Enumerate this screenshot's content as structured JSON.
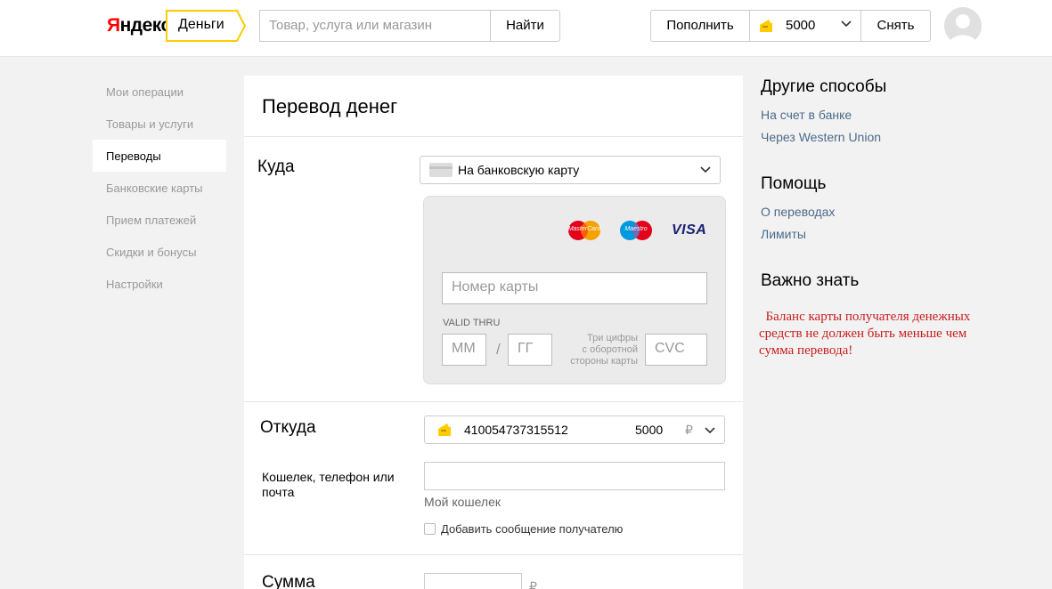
{
  "header": {
    "logo_y": "Я",
    "logo_rest": "ндекс",
    "service_tab": "Деньги",
    "search_placeholder": "Товар, услуга или магазин",
    "search_button": "Найти",
    "topup_button": "Пополнить",
    "balance": "5000",
    "withdraw_button": "Снять"
  },
  "sidebar": {
    "items": [
      {
        "label": "Мои операции",
        "active": false
      },
      {
        "label": "Товары и услуги",
        "active": false
      },
      {
        "label": "Переводы",
        "active": true
      },
      {
        "label": "Банковские карты",
        "active": false
      },
      {
        "label": "Прием платежей",
        "active": false
      },
      {
        "label": "Скидки и бонусы",
        "active": false
      },
      {
        "label": "Настройки",
        "active": false
      }
    ]
  },
  "main": {
    "title": "Перевод денег",
    "to": {
      "label": "Куда",
      "method_selected": "На банковскую карту",
      "card_logos": {
        "mastercard": "MasterCard",
        "maestro": "Maestro",
        "visa": "VISA"
      },
      "card_number_placeholder": "Номер карты",
      "valid_thru_label": "VALID THRU",
      "month_placeholder": "ММ",
      "date_separator": "/",
      "year_placeholder": "ГГ",
      "cvc_hint_lines": [
        "Три цифры",
        "с оборотной",
        "стороны карты"
      ],
      "cvc_placeholder": "CVC"
    },
    "from": {
      "label": "Откуда",
      "wallet_number": "410054737315512",
      "wallet_amount": "5000",
      "currency": "₽",
      "recipient_label": "Кошелек, телефон или почта",
      "recipient_value": "",
      "my_wallet_hint": "Мой кошелек",
      "add_message_label": "Добавить сообщение получателю",
      "add_message_checked": false
    },
    "amount": {
      "label": "Сумма",
      "currency": "₽"
    }
  },
  "right": {
    "other_methods": {
      "title": "Другие способы",
      "links": [
        "На счет в банке",
        "Через Western Union"
      ]
    },
    "help": {
      "title": "Помощь",
      "links": [
        "О переводах",
        "Лимиты"
      ]
    },
    "important": {
      "title": "Важно знать",
      "notice": "Баланс карты получателя денежных средств не должен быть меньше чем сумма перевода!"
    }
  },
  "colors": {
    "accent_yellow": "#ffcc00",
    "link_blue": "#4b6b8a",
    "notice_red": "#c81e1e"
  }
}
